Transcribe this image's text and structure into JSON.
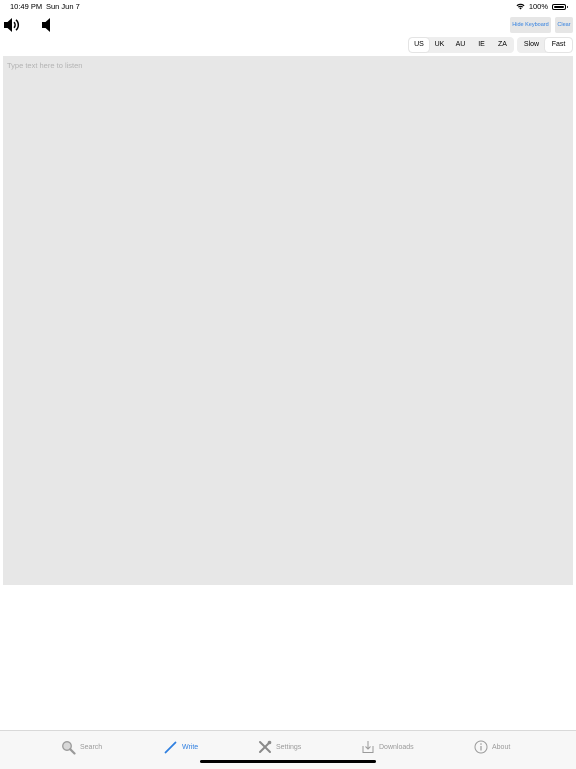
{
  "status_bar": {
    "time": "10:49 PM",
    "date": "Sun Jun 7",
    "battery": "100%"
  },
  "toolbar": {
    "volume_up_icon": "speaker-loud-icon",
    "volume_down_icon": "speaker-quiet-icon",
    "hide_keyboard_label": "Hide Keyboard",
    "clear_label": "Clear"
  },
  "accent_segment": {
    "items": [
      "US",
      "UK",
      "AU",
      "IE",
      "ZA"
    ],
    "selected": "US"
  },
  "speed_segment": {
    "items": [
      "Slow",
      "Fast"
    ],
    "selected": "Fast"
  },
  "editor": {
    "placeholder": "Type text here to listen"
  },
  "tab_bar": {
    "items": [
      {
        "label": "Search",
        "icon": "magnifier-icon"
      },
      {
        "label": "Write",
        "icon": "pencil-icon"
      },
      {
        "label": "Settings",
        "icon": "tools-icon"
      },
      {
        "label": "Downloads",
        "icon": "download-icon"
      },
      {
        "label": "About",
        "icon": "info-icon"
      }
    ],
    "active": "Write"
  },
  "colors": {
    "accent": "#2f7fe0",
    "editor_background": "#e7e7e7",
    "tab_inactive": "#9a9a9a"
  }
}
